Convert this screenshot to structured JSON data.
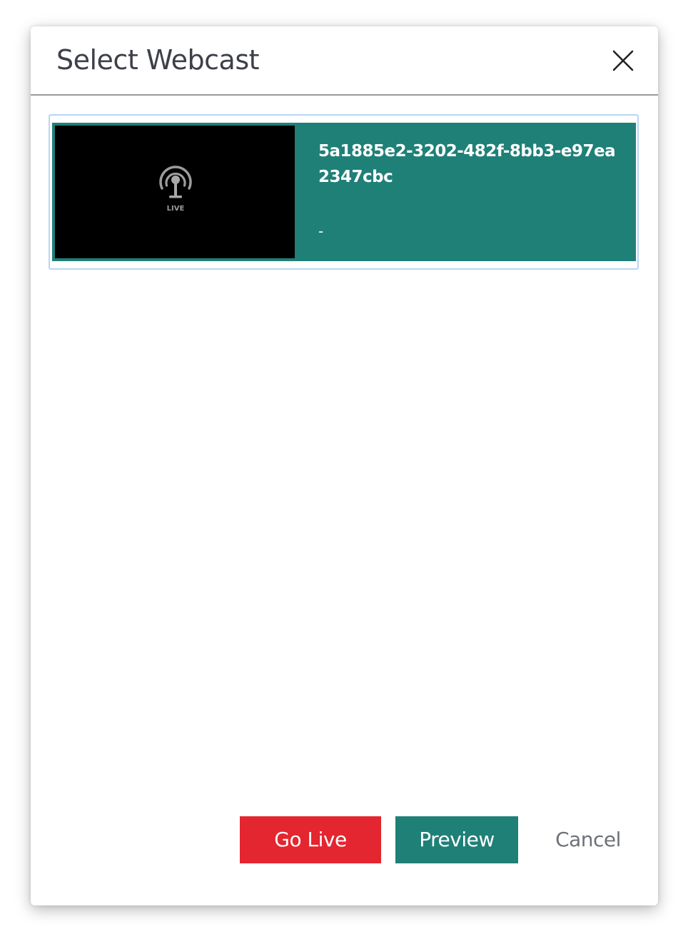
{
  "dialog": {
    "title": "Select Webcast",
    "close_icon": "close-icon"
  },
  "webcasts": [
    {
      "title": "5a1885e2-3202-482f-8bb3-e97ea2347cbc",
      "subtitle": "-",
      "thumbnail_label": "LIVE",
      "thumbnail_icon": "live-broadcast-icon",
      "selected": true
    }
  ],
  "footer": {
    "go_live_label": "Go Live",
    "preview_label": "Preview",
    "cancel_label": "Cancel"
  },
  "colors": {
    "accent_teal": "#1f8078",
    "go_live_red": "#e3262f",
    "selection_outline": "#b7d6f4",
    "title_text": "#3d3f4a",
    "cancel_text": "#6e7178"
  }
}
